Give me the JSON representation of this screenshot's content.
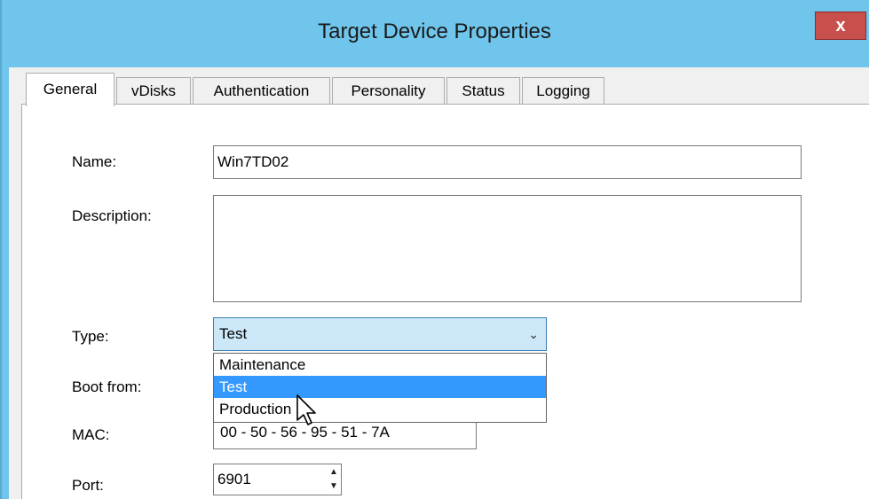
{
  "window": {
    "title": "Target Device Properties",
    "close_label": "x"
  },
  "tabs": [
    {
      "label": "General",
      "active": true
    },
    {
      "label": "vDisks",
      "active": false
    },
    {
      "label": "Authentication",
      "active": false
    },
    {
      "label": "Personality",
      "active": false
    },
    {
      "label": "Status",
      "active": false
    },
    {
      "label": "Logging",
      "active": false
    }
  ],
  "form": {
    "name_label": "Name:",
    "name_value": "Win7TD02",
    "description_label": "Description:",
    "description_value": "",
    "type_label": "Type:",
    "type_value": "Test",
    "type_options": [
      "Maintenance",
      "Test",
      "Production"
    ],
    "type_highlighted": "Test",
    "boot_label": "Boot from:",
    "mac_label": "MAC:",
    "mac_value": "00 - 50 - 56 - 95 - 51 - 7A",
    "port_label": "Port:",
    "port_value": "6901"
  },
  "colors": {
    "title_bar": "#6fc5ec",
    "close_button": "#c7504c",
    "selection": "#3399ff",
    "combo_focus": "#cce8f8"
  }
}
